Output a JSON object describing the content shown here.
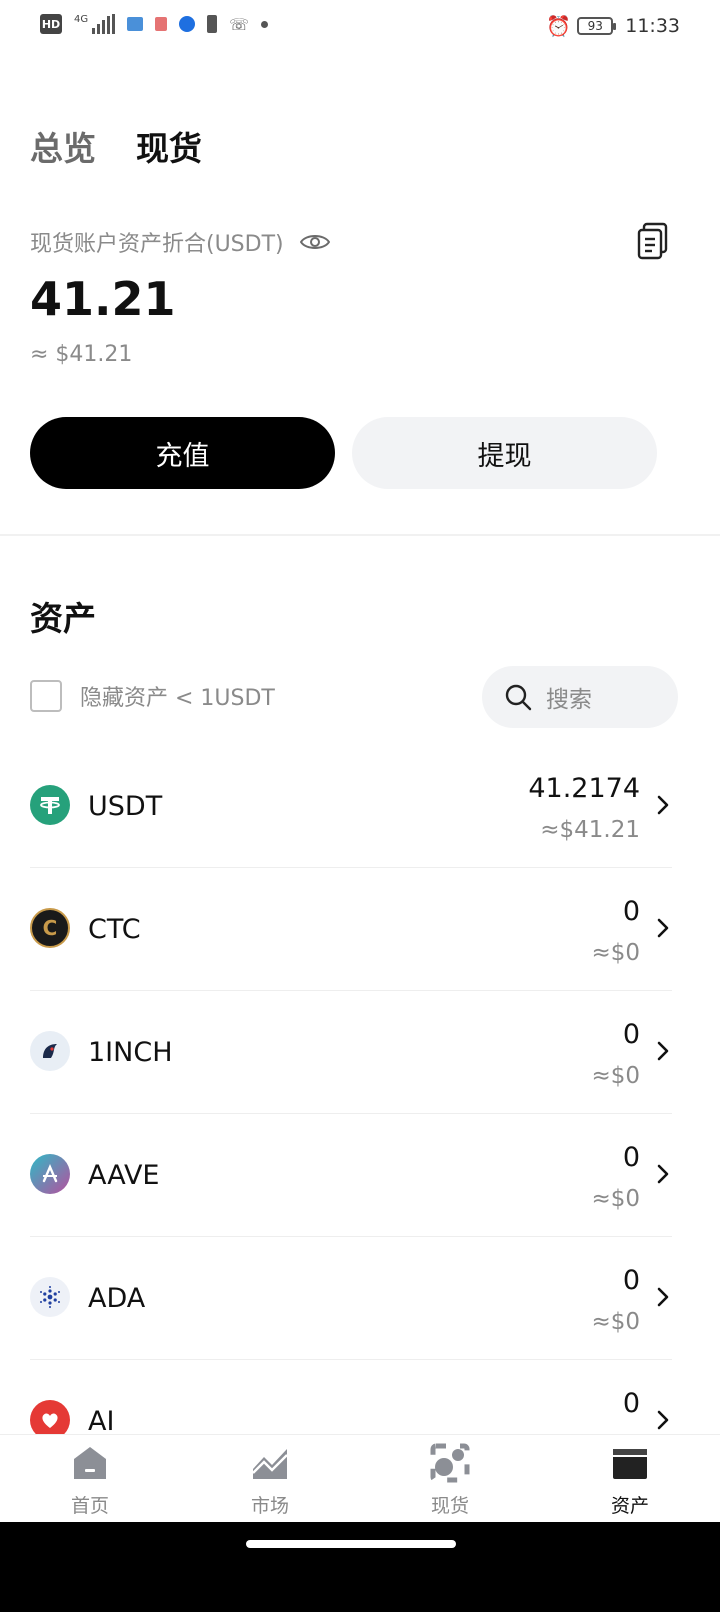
{
  "status_bar": {
    "network": "4G",
    "hd": "HD",
    "battery": "93",
    "time": "11:33"
  },
  "tabs": [
    {
      "label": "总览",
      "active": false
    },
    {
      "label": "现货",
      "active": true
    }
  ],
  "balance": {
    "label": "现货账户资产折合(USDT)",
    "value": "41.21",
    "usd": "≈ $41.21"
  },
  "actions": {
    "deposit": "充值",
    "withdraw": "提现"
  },
  "assets": {
    "title": "资产",
    "hide_small_label": "隐藏资产 < 1USDT",
    "search_placeholder": "搜索",
    "items": [
      {
        "symbol": "USDT",
        "amount": "41.2174",
        "usd": "≈$41.21",
        "color": "#26a17b"
      },
      {
        "symbol": "CTC",
        "amount": "0",
        "usd": "≈$0",
        "color": "#1a1a1a"
      },
      {
        "symbol": "1INCH",
        "amount": "0",
        "usd": "≈$0",
        "color": "#e8eef5"
      },
      {
        "symbol": "AAVE",
        "amount": "0",
        "usd": "≈$0",
        "color": "#8a5fb3"
      },
      {
        "symbol": "ADA",
        "amount": "0",
        "usd": "≈$0",
        "color": "#eef1f7"
      },
      {
        "symbol": "AI",
        "amount": "0",
        "usd": "",
        "color": "#e53935"
      }
    ]
  },
  "bottom_nav": [
    {
      "label": "首页",
      "icon": "home-icon",
      "active": false
    },
    {
      "label": "市场",
      "icon": "market-chart-icon",
      "active": false
    },
    {
      "label": "现货",
      "icon": "spot-icon",
      "active": false
    },
    {
      "label": "资产",
      "icon": "wallet-icon",
      "active": true
    }
  ],
  "colors": {
    "primary_button": "#000000",
    "secondary_button": "#f2f3f5",
    "muted_text": "#8a8a8a",
    "nav_inactive_icon": "#8c8f96"
  }
}
